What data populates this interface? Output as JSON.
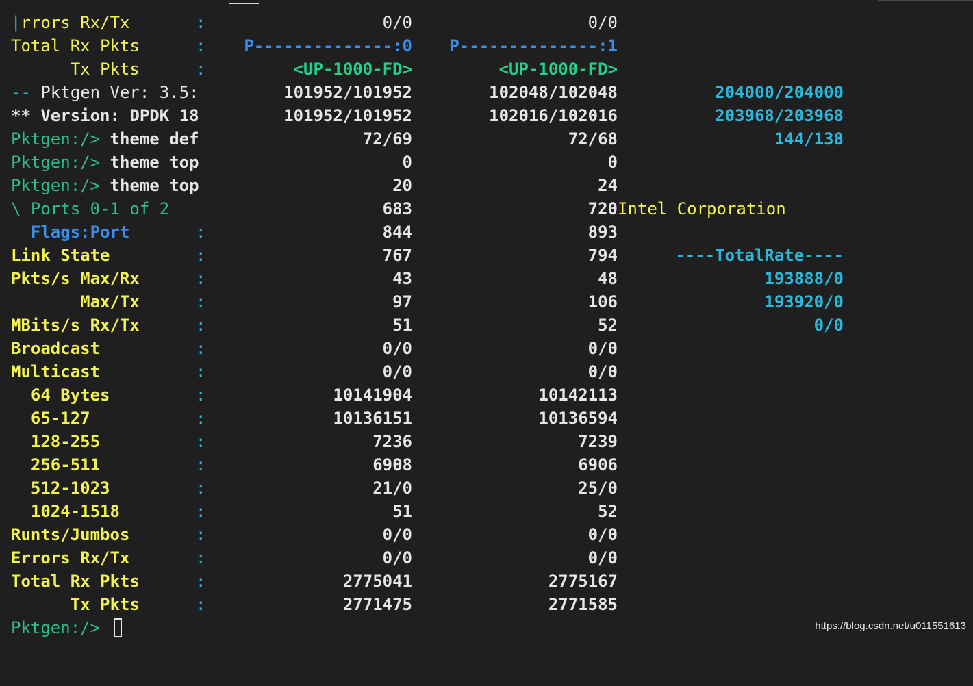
{
  "colors": {
    "background": "#1f1f1f",
    "label_yellow": "#f2f250",
    "value_white": "#e6e6e6",
    "port_blue": "#3b8eea",
    "link_green": "#23d18b",
    "total_cyan": "#29b8db",
    "prompt_green": "#2bbd8b",
    "cyan_pipe": "#29b8db"
  },
  "icons": {
    "cursor": "block-cursor-icon"
  },
  "lines": [
    {
      "label": "|rrors Rx/Tx",
      "colon": ":",
      "c0": "0/0",
      "c1": "0/0",
      "c2": ""
    },
    {
      "label": "Total Rx Pkts",
      "colon": ":",
      "c0": "P--------------:0",
      "c1": "P--------------:1",
      "c2": ""
    },
    {
      "label": "      Tx Pkts",
      "colon": ":",
      "c0": "<UP-1000-FD>",
      "c1": "<UP-1000-FD>",
      "c2": ""
    },
    {
      "label": "-- Pktgen Ver: 3.5:",
      "colon": "",
      "c0": "101952/101952",
      "c1": "102048/102048",
      "c2": "204000/204000"
    },
    {
      "label": "** Version: DPDK 18",
      "colon": "",
      "c0": "101952/101952",
      "c1": "102016/102016",
      "c2": "203968/203968"
    },
    {
      "label": "Pktgen:/> ",
      "label2": "theme def",
      "colon": "",
      "c0": "72/69",
      "c1": "72/68",
      "c2": "144/138"
    },
    {
      "label": "Pktgen:/> ",
      "label2": "theme top",
      "colon": "",
      "c0": "0",
      "c1": "0",
      "c2": ""
    },
    {
      "label": "Pktgen:/> ",
      "label2": "theme top",
      "colon": "",
      "c0": "20",
      "c1": "24",
      "c2": ""
    },
    {
      "label": "\\ Ports 0-1 of 2",
      "colon": "",
      "c0": "683",
      "c1": "720",
      "c2": "Intel Corporation"
    },
    {
      "label": "  Flags:Port",
      "colon": ":",
      "c0": "844",
      "c1": "893",
      "c2": ""
    },
    {
      "label": "Link State",
      "colon": ":",
      "c0": "767",
      "c1": "794",
      "c2": "----TotalRate----"
    },
    {
      "label": "Pkts/s Max/Rx",
      "colon": ":",
      "c0": "43",
      "c1": "48",
      "c2": "193888/0"
    },
    {
      "label": "       Max/Tx",
      "colon": ":",
      "c0": "97",
      "c1": "106",
      "c2": "193920/0"
    },
    {
      "label": "MBits/s Rx/Tx",
      "colon": ":",
      "c0": "51",
      "c1": "52",
      "c2": "0/0"
    },
    {
      "label": "Broadcast",
      "colon": ":",
      "c0": "0/0",
      "c1": "0/0",
      "c2": ""
    },
    {
      "label": "Multicast",
      "colon": ":",
      "c0": "0/0",
      "c1": "0/0",
      "c2": ""
    },
    {
      "label": "  64 Bytes",
      "colon": ":",
      "c0": "10141904",
      "c1": "10142113",
      "c2": ""
    },
    {
      "label": "  65-127",
      "colon": ":",
      "c0": "10136151",
      "c1": "10136594",
      "c2": ""
    },
    {
      "label": "  128-255",
      "colon": ":",
      "c0": "7236",
      "c1": "7239",
      "c2": ""
    },
    {
      "label": "  256-511",
      "colon": ":",
      "c0": "6908",
      "c1": "6906",
      "c2": ""
    },
    {
      "label": "  512-1023",
      "colon": ":",
      "c0": "21/0",
      "c1": "25/0",
      "c2": ""
    },
    {
      "label": "  1024-1518",
      "colon": ":",
      "c0": "51",
      "c1": "52",
      "c2": ""
    },
    {
      "label": "Runts/Jumbos",
      "colon": ":",
      "c0": "0/0",
      "c1": "0/0",
      "c2": ""
    },
    {
      "label": "Errors Rx/Tx",
      "colon": ":",
      "c0": "0/0",
      "c1": "0/0",
      "c2": ""
    },
    {
      "label": "Total Rx Pkts",
      "colon": ":",
      "c0": "2775041",
      "c1": "2775167",
      "c2": ""
    },
    {
      "label": "      Tx Pkts",
      "colon": ":",
      "c0": "2771475",
      "c1": "2771585",
      "c2": ""
    }
  ],
  "prompt": {
    "text": "Pktgen:/> "
  },
  "watermark": "https://blog.csdn.net/u011551613"
}
